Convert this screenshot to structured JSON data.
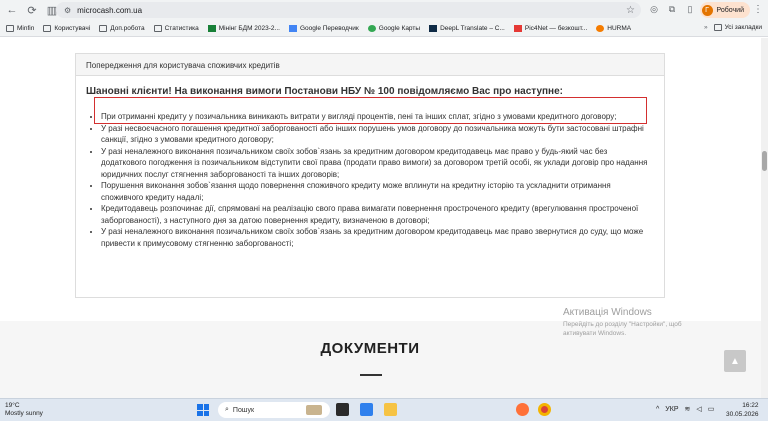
{
  "browser": {
    "url": "microcash.com.ua",
    "profile_initial": "Г",
    "profile_label": "Робочий",
    "bookmarks": [
      {
        "label": "Minfin",
        "icon": "folder-icon"
      },
      {
        "label": "Користувачі",
        "icon": "folder-icon"
      },
      {
        "label": "Доп.робота",
        "icon": "folder-icon"
      },
      {
        "label": "Статистика",
        "icon": "folder-icon"
      },
      {
        "label": "Мінінг БДМ 2023-2...",
        "icon": "sheet-icon"
      },
      {
        "label": "Google Переводчик",
        "icon": "translate-icon"
      },
      {
        "label": "Google Карты",
        "icon": "maps-icon"
      },
      {
        "label": "DeepL Translate – С...",
        "icon": "deepl-icon"
      },
      {
        "label": "Pic4Net — безкошт...",
        "icon": "pic4net-icon"
      },
      {
        "label": "HURMA",
        "icon": "hurma-icon"
      }
    ],
    "all_bookmarks_label": "Усі закладки"
  },
  "warning_panel": {
    "heading": "Попередження для користувача споживчих кредитів",
    "intro": "Шановні клієнти! На виконання вимоги Постанови НБУ № 100 повідомляємо Вас про наступне:",
    "items": [
      "При отриманні кредиту у позичальника виникають витрати у вигляді процентів, пені та інших сплат, згідно з умовами кредитного договору;",
      "У разі несвоєчасного погашення кредитної заборгованості або інших порушень умов договору до позичальника можуть бути застосовані штрафні санкції, згідно з умовами кредитного договору;",
      "У разі неналежного виконання позичальником своїх зобов`язань за кредитним договором кредитодавець має право у будь-який час без додаткового погодження із позичальником відступити свої права (продати право вимоги) за договором третій особі, як уклади договір про надання юридичних послуг стягнення заборгованості та інших договорів;",
      "Порушення виконання зобов`язання щодо повернення споживчого кредиту може вплинути на кредитну історію та ускладнити отримання споживчого кредиту надалі;",
      "Кредитодавець розпочинає дії, спрямовані на реалізацію свого права вимагати повернення простроченого кредиту (врегулювання простроченої заборгованості), з наступного дня за датою повернення кредиту, визначеною в договорі;",
      "У разі неналежного виконання позичальником своїх зобов`язань за кредитним договором кредитодавець має право звернутися до суду, що може привести к примусовому стягненню заборгованості;"
    ]
  },
  "documents_title": "ДОКУМЕНТИ",
  "activation": {
    "title": "Активація Windows",
    "text": "Перейдіть до розділу \"Настройки\", щоб активувати Windows."
  },
  "taskbar": {
    "temperature": "19°C",
    "weather": "Mostly sunny",
    "search_label": "Пошук",
    "language": "УКР",
    "time": "16:22",
    "date": "30.05.2026"
  }
}
